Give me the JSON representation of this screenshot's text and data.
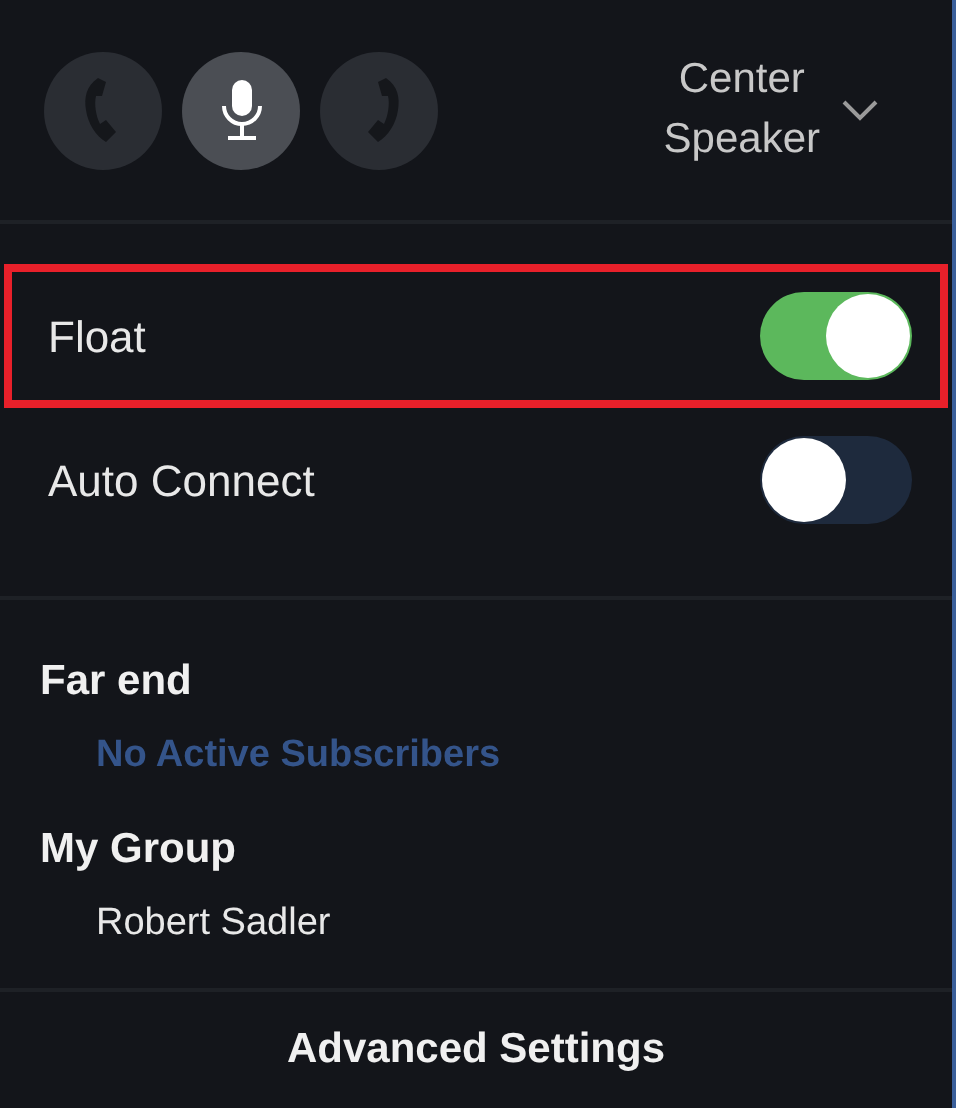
{
  "modes": [
    {
      "kind": "call-left",
      "selected": false
    },
    {
      "kind": "mic",
      "selected": true
    },
    {
      "kind": "call-right",
      "selected": false
    }
  ],
  "output": {
    "label_lines": [
      "Center",
      "Speaker"
    ]
  },
  "toggles": [
    {
      "label": "Float",
      "on": true,
      "highlighted": true
    },
    {
      "label": "Auto Connect",
      "on": false,
      "highlighted": false
    }
  ],
  "sections": [
    {
      "title": "Far end",
      "items": [
        {
          "text": "No Active Subscribers",
          "muted": true
        }
      ]
    },
    {
      "title": "My Group",
      "items": [
        {
          "text": "Robert Sadler",
          "muted": false
        }
      ]
    }
  ],
  "footer_button": "Advanced Settings"
}
